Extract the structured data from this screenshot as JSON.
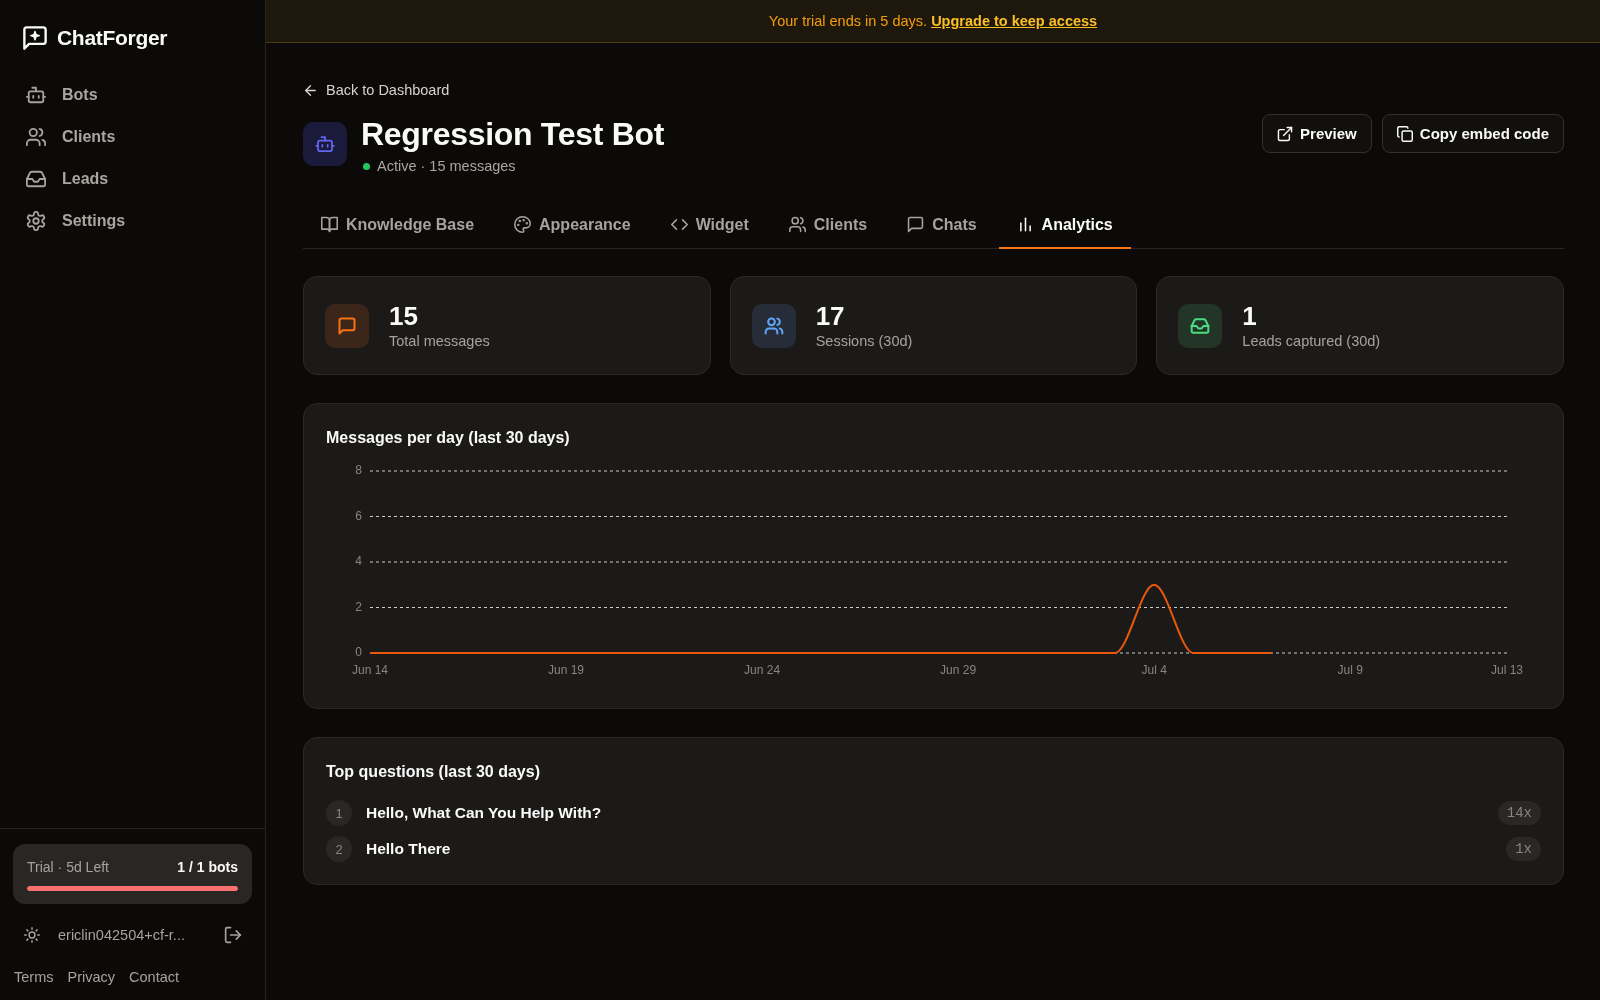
{
  "sidebar": {
    "logo": "ChatForger",
    "nav": [
      {
        "label": "Bots",
        "kind": "bots",
        "selected": false
      },
      {
        "label": "Clients",
        "kind": "clients",
        "selected": false
      },
      {
        "label": "Leads",
        "kind": "leads",
        "selected": false
      },
      {
        "label": "Settings",
        "kind": "settings",
        "selected": false
      }
    ],
    "trial": {
      "label": "Trial · 5d Left",
      "usage": "1 / 1 bots",
      "level": 1
    },
    "user": {
      "email": "ericlin042504+cf-r..."
    },
    "footer_links": [
      "Terms",
      "Privacy",
      "Contact"
    ]
  },
  "banner": {
    "text": "Your trial ends in 5 days.",
    "link": "Upgrade to keep access"
  },
  "header": {
    "back_link": "Back to Dashboard",
    "bot": {
      "name": "Regression Test Bot",
      "active": true,
      "status": "Active · 15 messages"
    },
    "buttons": [
      {
        "label": "Preview",
        "kind": "preview"
      },
      {
        "label": "Copy embed code",
        "kind": "copy"
      }
    ]
  },
  "tabs": [
    {
      "label": "Knowledge Base",
      "kind": "knowledge",
      "selected": false
    },
    {
      "label": "Appearance",
      "kind": "appearance",
      "selected": false
    },
    {
      "label": "Widget",
      "kind": "widget",
      "selected": false
    },
    {
      "label": "Clients",
      "kind": "clients",
      "selected": false
    },
    {
      "label": "Chats",
      "kind": "chats",
      "selected": false
    },
    {
      "label": "Analytics",
      "kind": "analytics",
      "selected": true
    }
  ],
  "stats": [
    {
      "value": "15",
      "label": "Total messages",
      "kind": "messages",
      "color": "#f97316"
    },
    {
      "value": "17",
      "label": "Sessions (30d)",
      "kind": "sessions",
      "color": "#60a5fa"
    },
    {
      "value": "1",
      "label": "Leads captured (30d)",
      "kind": "leads",
      "color": "#4ade80"
    }
  ],
  "messages_chart": {
    "chart_data": {
      "type": "line",
      "title": "Messages per day (last 30 days)",
      "categories": [
        "Jun 14",
        null,
        null,
        null,
        null,
        "Jun 19",
        null,
        null,
        null,
        null,
        "Jun 24",
        null,
        null,
        null,
        null,
        "Jun 29",
        null,
        null,
        null,
        null,
        "Jul 4",
        null,
        null,
        null,
        null,
        "Jul 9",
        null,
        null,
        null,
        "Jul 13"
      ],
      "ylim": [
        0,
        8
      ],
      "yticks": [
        0,
        2,
        4,
        6,
        8
      ],
      "grid": true,
      "series": [
        {
          "color": "#ea580c",
          "values": [
            0,
            0,
            0,
            0,
            0,
            0,
            0,
            0,
            0,
            0,
            0,
            0,
            0,
            0,
            0,
            0,
            0,
            0,
            0,
            0,
            3,
            0,
            0,
            0,
            null,
            null,
            null,
            null,
            null,
            null
          ]
        }
      ]
    }
  },
  "top_questions": {
    "title": "Top questions (last 30 days)",
    "items": [
      {
        "rank": "1",
        "question": "Hello, What Can You Help With?",
        "count": "14x"
      },
      {
        "rank": "2",
        "question": "Hello There",
        "count": "1x"
      }
    ]
  }
}
